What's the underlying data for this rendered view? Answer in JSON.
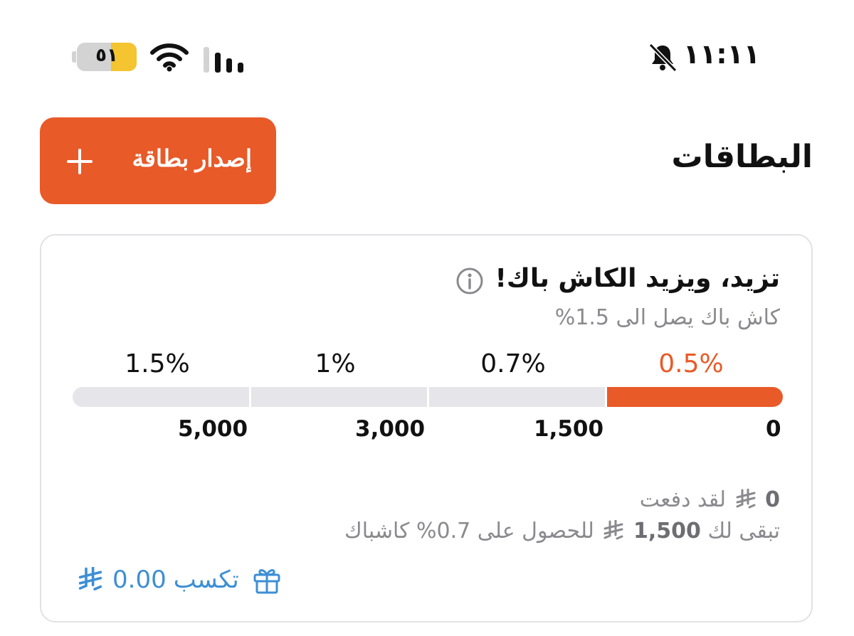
{
  "status_bar": {
    "time": "١١:١١",
    "battery": "٥١",
    "icons": [
      "bell-slash-icon",
      "wifi-icon",
      "cellular-signal-icon",
      "battery-icon"
    ]
  },
  "header": {
    "title": "البطاقات",
    "issue_button_label": "إصدار بطاقة"
  },
  "promo": {
    "title": "تزيد، ويزيد الكاش باك!",
    "subtitle": "كاش باك يصل الى 1.5%",
    "tiers": [
      {
        "percent": "0.5%",
        "threshold": "0",
        "active": true
      },
      {
        "percent": "0.7%",
        "threshold": "1,500",
        "active": false
      },
      {
        "percent": "1%",
        "threshold": "3,000",
        "active": false
      },
      {
        "percent": "1.5%",
        "threshold": "5,000",
        "active": false
      }
    ],
    "paid_amount": "0",
    "paid_label": "لقد دفعت",
    "remaining_prefix": "تبقى لك",
    "remaining_amount": "1,500",
    "remaining_suffix": "للحصول على 0.7% كاشباك",
    "earn_label": "تكسب",
    "earn_amount": "0.00"
  },
  "colors": {
    "accent": "#e85a28",
    "link": "#3d8fd4",
    "muted": "#8a8a8e",
    "track": "#e6e6ea"
  }
}
